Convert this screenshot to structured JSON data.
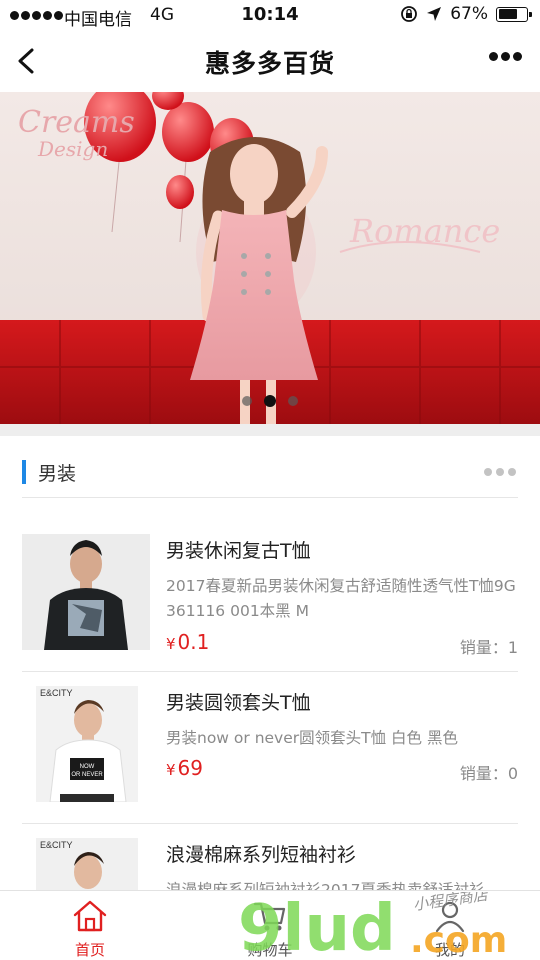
{
  "status_bar": {
    "carrier": "中国电信",
    "network": "4G",
    "time": "10:14",
    "battery": "67%",
    "battery_level": 0.67,
    "icons": [
      "lock-rotation-icon",
      "location-arrow-icon",
      "battery-icon"
    ]
  },
  "nav": {
    "title": "惠多多百货",
    "back_icon": "chevron-left-icon",
    "more_icon": "more-dots-icon"
  },
  "banner": {
    "slide_count": 3,
    "active_slide": 2,
    "logo_text": "Creams Design",
    "script_text": "Romance"
  },
  "section": {
    "title": "男装",
    "accent_color": "#1e88e5"
  },
  "products": [
    {
      "name": "男装休闲复古T恤",
      "desc": "2017春夏新品男装休闲复古舒适随性透气性T恤9G361116 001本黑 M",
      "currency": "¥",
      "price": "0.1",
      "sales": "销量：1"
    },
    {
      "name": "男装圆领套头T恤",
      "desc": "男装now or never圆领套头T恤 白色 黑色",
      "currency": "¥",
      "price": "69",
      "sales": "销量：0",
      "shirt_text_1": "NOW",
      "shirt_text_2": "OR NEVER",
      "brand": "E&CITY"
    },
    {
      "name": "浪漫棉麻系列短袖衬衫",
      "desc": "浪漫棉麻系列短袖衬衫2017夏季热卖舒适衬衫",
      "brand": "E&CITY"
    }
  ],
  "price_color": "#e02020",
  "tabs": [
    {
      "label": "首页",
      "icon": "home-icon",
      "active": true
    },
    {
      "label": "购物车",
      "icon": "cart-icon",
      "active": false
    },
    {
      "label": "我的",
      "icon": "user-icon",
      "active": false
    }
  ],
  "watermark": {
    "logo": "9lud",
    "suffix": ".com",
    "tagline": "小程序商店"
  }
}
